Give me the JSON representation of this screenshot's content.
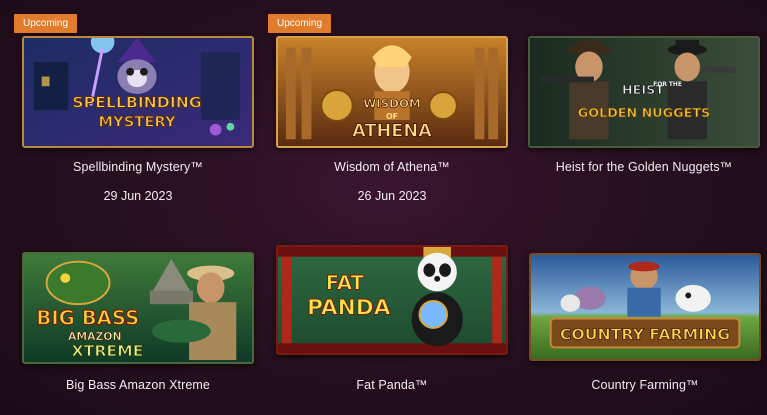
{
  "games": [
    {
      "name": "Spellbinding Mystery™",
      "badge": "Upcoming",
      "date": "29 Jun 2023",
      "logo": [
        "SPELLBINDING",
        "MYSTERY"
      ],
      "palette": {
        "bg1": "#1d2c63",
        "bg2": "#3c2a7a",
        "accent": "#7fd0ff",
        "logo": "#f5c74a"
      }
    },
    {
      "name": "Wisdom of Athena™",
      "badge": "Upcoming",
      "date": "26 Jun 2023",
      "logo": [
        "WISDOM",
        "OF",
        "ATHENA"
      ],
      "palette": {
        "bg1": "#5a2b10",
        "bg2": "#c9822a",
        "accent": "#ffd37a",
        "logo": "#ffdf8a"
      }
    },
    {
      "name": "Heist for the Golden Nuggets™",
      "badge": "",
      "date": "",
      "logo": [
        "HEIST",
        "FOR THE",
        "GOLDEN NUGGETS"
      ],
      "palette": {
        "bg1": "#1a2a1f",
        "bg2": "#3b4d3a",
        "accent": "#9fb28a",
        "logo": "#f2c43a"
      }
    },
    {
      "name": "Big Bass Amazon Xtreme",
      "badge": "",
      "date": "",
      "logo": [
        "BIG BASS",
        "AMAZON",
        "XTREME"
      ],
      "palette": {
        "bg1": "#0f3a27",
        "bg2": "#3f7a3a",
        "accent": "#d7a83f",
        "logo": "#f5d23a"
      }
    },
    {
      "name": "Fat Panda™",
      "badge": "",
      "date": "",
      "logo": [
        "FAT",
        "PANDA"
      ],
      "palette": {
        "bg1": "#1e4a30",
        "bg2": "#6a1010",
        "accent": "#ffcf3a",
        "logo": "#ffe34a"
      }
    },
    {
      "name": "Country Farming™",
      "badge": "",
      "date": "",
      "logo": [
        "COUNTRY FARMING"
      ],
      "palette": {
        "bg1": "#2c5a9a",
        "bg2": "#6ea640",
        "accent": "#c9893a",
        "logo": "#ffd34a"
      }
    }
  ]
}
